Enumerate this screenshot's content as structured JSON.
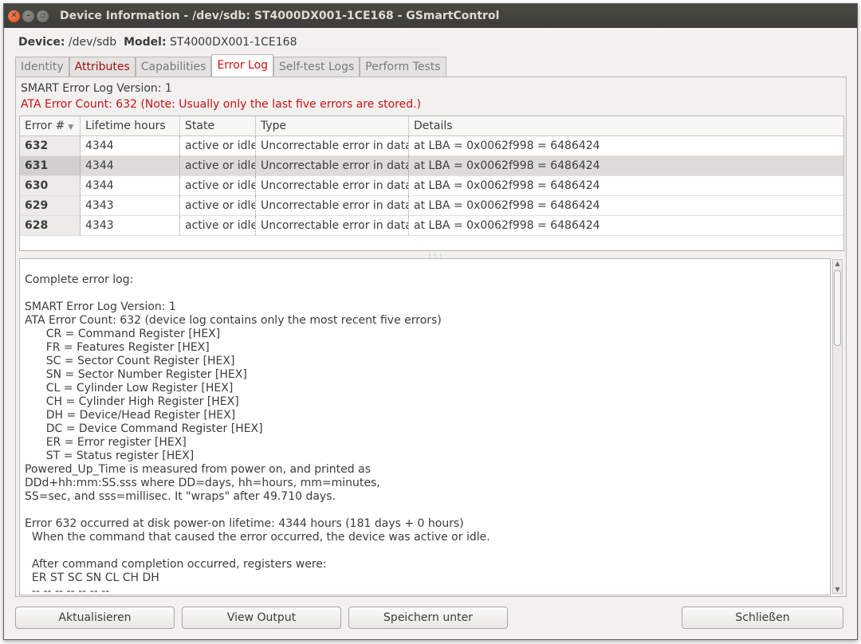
{
  "window": {
    "title": "Device Information - /dev/sdb: ST4000DX001-1CE168 - GSmartControl"
  },
  "device": {
    "device_label": "Device:",
    "device_value": "/dev/sdb",
    "model_label": "Model:",
    "model_value": "ST4000DX001-1CE168"
  },
  "tabs": [
    "Identity",
    "Attributes",
    "Capabilities",
    "Error Log",
    "Self-test Logs",
    "Perform Tests"
  ],
  "active_tab": "Error Log",
  "errorlog": {
    "version": "SMART Error Log Version: 1",
    "count": "ATA Error Count: 632 (Note: Usually only the last five errors are stored.)",
    "columns": [
      "Error #",
      "Lifetime hours",
      "State",
      "Type",
      "Details"
    ],
    "rows": [
      [
        "632",
        "4344",
        "active or idle",
        "Uncorrectable error in data",
        "at LBA = 0x0062f998 = 6486424"
      ],
      [
        "631",
        "4344",
        "active or idle",
        "Uncorrectable error in data",
        "at LBA = 0x0062f998 = 6486424"
      ],
      [
        "630",
        "4344",
        "active or idle",
        "Uncorrectable error in data",
        "at LBA = 0x0062f998 = 6486424"
      ],
      [
        "629",
        "4343",
        "active or idle",
        "Uncorrectable error in data",
        "at LBA = 0x0062f998 = 6486424"
      ],
      [
        "628",
        "4343",
        "active or idle",
        "Uncorrectable error in data",
        "at LBA = 0x0062f998 = 6486424"
      ]
    ],
    "selected_row": "631",
    "complete_log": "Complete error log:\n\nSMART Error Log Version: 1\nATA Error Count: 632 (device log contains only the most recent five errors)\n      CR = Command Register [HEX]\n      FR = Features Register [HEX]\n      SC = Sector Count Register [HEX]\n      SN = Sector Number Register [HEX]\n      CL = Cylinder Low Register [HEX]\n      CH = Cylinder High Register [HEX]\n      DH = Device/Head Register [HEX]\n      DC = Device Command Register [HEX]\n      ER = Error register [HEX]\n      ST = Status register [HEX]\nPowered_Up_Time is measured from power on, and printed as\nDDd+hh:mm:SS.sss where DD=days, hh=hours, mm=minutes,\nSS=sec, and sss=millisec. It \"wraps\" after 49.710 days.\n\nError 632 occurred at disk power-on lifetime: 4344 hours (181 days + 0 hours)\n  When the command that caused the error occurred, the device was active or idle.\n\n  After command completion occurred, registers were:\n  ER ST SC SN CL CH DH\n  -- -- -- -- -- -- --"
  },
  "buttons": {
    "refresh": "Aktualisieren",
    "view_output": "View Output",
    "save_as": "Speichern unter",
    "close": "Schließen"
  },
  "icons": {
    "close": "close-icon",
    "minimize": "minimize-icon",
    "maximize": "maximize-icon",
    "sort": "sort-descending-icon"
  },
  "colors": {
    "error_red": "#cc1111",
    "titlebar": "#3c3b37",
    "close_button": "#dd4814"
  }
}
